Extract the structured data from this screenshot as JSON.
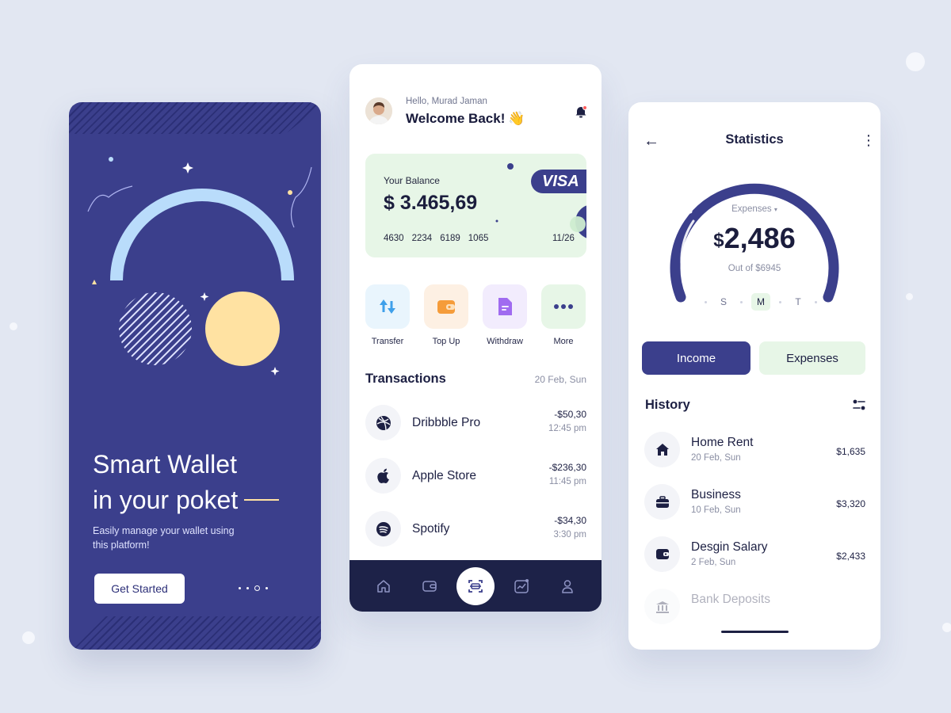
{
  "onboarding": {
    "title_line1": "Smart Wallet",
    "title_line2": "in your poket",
    "description": "Easily manage your wallet using this platform!",
    "cta_label": "Get Started",
    "colors": {
      "background": "#3b3f8c",
      "arc": "#b9dcfb",
      "circle": "#ffe2a2"
    }
  },
  "home": {
    "greeting": "Hello, Murad Jaman",
    "welcome": "Welcome Back!",
    "wave_emoji": "👋",
    "card": {
      "label": "Your Balance",
      "balance": "$ 3.465,69",
      "number_groups": [
        "4630",
        "2234",
        "6189",
        "1065"
      ],
      "expiry": "11/26",
      "brand": "VISA"
    },
    "actions": [
      {
        "label": "Transfer",
        "icon": "transfer-icon",
        "bg": "#e9f5fd"
      },
      {
        "label": "Top Up",
        "icon": "wallet-icon",
        "bg": "#fdf0e3"
      },
      {
        "label": "Withdraw",
        "icon": "document-icon",
        "bg": "#f2ecfd"
      },
      {
        "label": "More",
        "icon": "more-icon",
        "bg": "#e7f6e7"
      }
    ],
    "transactions_title": "Transactions",
    "transactions_date": "20 Feb, Sun",
    "transactions": [
      {
        "name": "Dribbble Pro",
        "amount": "-$50,30",
        "time": "12:45 pm",
        "icon": "dribbble-icon"
      },
      {
        "name": "Apple Store",
        "amount": "-$236,30",
        "time": "11:45 pm",
        "icon": "apple-icon"
      },
      {
        "name": "Spotify",
        "amount": "-$34,30",
        "time": "3:30 pm",
        "icon": "spotify-icon"
      }
    ],
    "nav": [
      "home-icon",
      "wallet-icon",
      "scan-icon",
      "chart-icon",
      "profile-icon"
    ],
    "nav_active": "scan-icon"
  },
  "stats": {
    "title": "Statistics",
    "gauge_label": "Expenses",
    "gauge_value": "2,486",
    "gauge_currency": "$",
    "gauge_sub": "Out of $6945",
    "days": [
      "S",
      "M",
      "T"
    ],
    "active_day": "M",
    "tab_income": "Income",
    "tab_expenses": "Expenses",
    "history_title": "History",
    "history": [
      {
        "name": "Home Rent",
        "date": "20 Feb, Sun",
        "amount": "$1,635",
        "icon": "house-icon"
      },
      {
        "name": "Business",
        "date": "10 Feb, Sun",
        "amount": "$3,320",
        "icon": "briefcase-icon"
      },
      {
        "name": "Desgin Salary",
        "date": "2 Feb, Sun",
        "amount": "$2,433",
        "icon": "wallet-icon"
      },
      {
        "name": "Bank Deposits",
        "date": "",
        "amount": "",
        "icon": "bank-icon"
      }
    ],
    "accent_color": "#3b3f8c"
  }
}
